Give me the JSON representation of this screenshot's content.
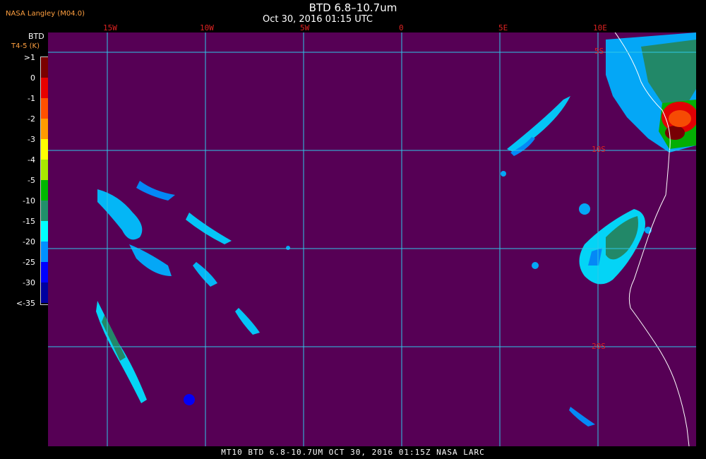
{
  "header": {
    "org": "NASA Langley (M04.0)",
    "title": "BTD 6.8–10.7um",
    "time": "Oct 30, 2016 01:15 UTC"
  },
  "legend": {
    "title1": "BTD",
    "title2": "T4-5 (K)",
    "labels": [
      ">1",
      "0",
      "-1",
      "-2",
      "-3",
      "-4",
      "-5",
      "-10",
      "-15",
      "-20",
      "-25",
      "-30",
      "<-35"
    ],
    "colors": [
      "#7a0000",
      "#e80000",
      "#ff5000",
      "#ff9a00",
      "#ffff00",
      "#a8e800",
      "#00b800",
      "#20906a",
      "#00ffff",
      "#0090ff",
      "#0000ff",
      "#0000a0",
      "#560055"
    ]
  },
  "grid": {
    "lon_labels": [
      "15W",
      "10W",
      "5W",
      "0",
      "5E",
      "10E"
    ],
    "lat_labels": [
      "5S",
      "10S",
      "20S"
    ],
    "color": "#2ec8e8"
  },
  "footer": {
    "text": "MT10  BTD 6.8-10.7UM  OCT 30, 2016 01:15Z  NASA LARC"
  }
}
